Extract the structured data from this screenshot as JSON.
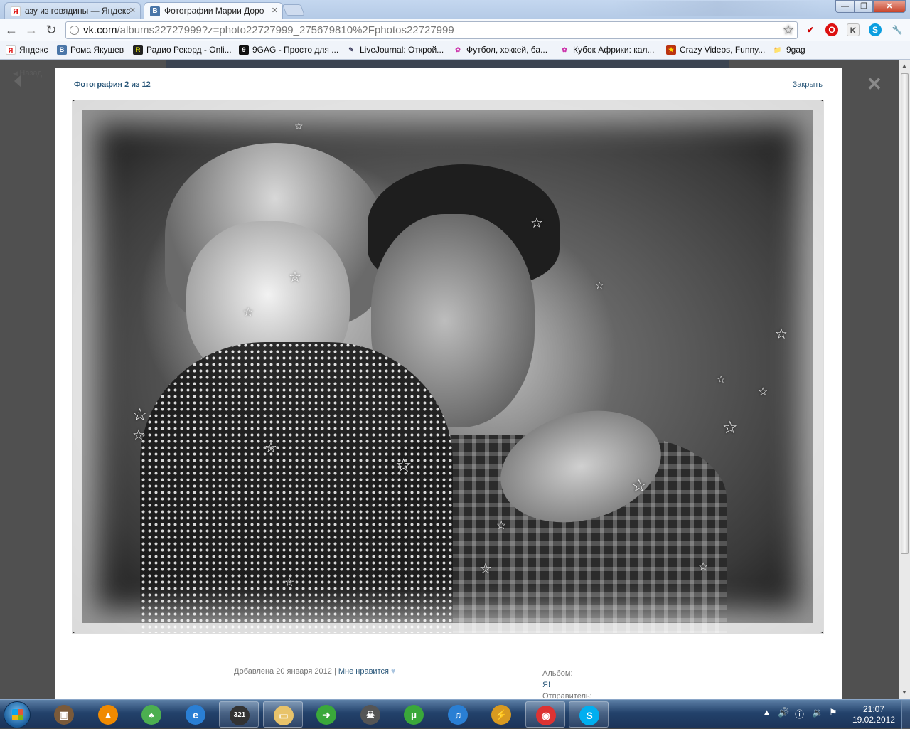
{
  "browser": {
    "tabs": [
      {
        "title": "азу из говядины — Яндекс",
        "favicon": "Я",
        "active": false
      },
      {
        "title": "Фотографии Марии Доро",
        "favicon": "В",
        "active": true
      }
    ],
    "url_host": "vk.com",
    "url_path": "/albums22727999?z=photo22727999_275679810%2Fphotos22727999",
    "bookmarks": [
      {
        "label": "Яндекс",
        "icon": "Я"
      },
      {
        "label": "Рома Якушев",
        "icon": "В"
      },
      {
        "label": "Радио Рекорд - Onli...",
        "icon": "R"
      },
      {
        "label": "9GAG - Просто для ...",
        "icon": "9"
      },
      {
        "label": "LiveJournal: Открой...",
        "icon": "✎"
      },
      {
        "label": "Футбол, хоккей, ба...",
        "icon": "✿"
      },
      {
        "label": "Кубок Африки: кал...",
        "icon": "✿"
      },
      {
        "label": "Crazy Videos, Funny...",
        "icon": "★"
      },
      {
        "label": "9gag",
        "icon": "📁"
      }
    ]
  },
  "page": {
    "back_label": "Назад",
    "counter": "Фотография 2 из 12",
    "close_label": "Закрыть",
    "added_text": "Добавлена 20 января 2012",
    "separator": "|",
    "like_label": "Мне нравится",
    "like_icon": "♥",
    "album_label": "Альбом:",
    "album_value": "Я!",
    "sender_label": "Отправитель:"
  },
  "taskbar": {
    "apps": [
      {
        "name": "archive-app-icon",
        "glyph": "▣",
        "color": "#7a5a3a",
        "open": false
      },
      {
        "name": "vlc-icon",
        "glyph": "▲",
        "color": "#f08a00",
        "open": false
      },
      {
        "name": "green-app-icon",
        "glyph": "♠",
        "color": "#4caf50",
        "open": false
      },
      {
        "name": "internet-explorer-icon",
        "glyph": "e",
        "color": "#2a7fd4",
        "open": false
      },
      {
        "name": "media-player-classic-icon",
        "glyph": "321",
        "color": "#333",
        "open": true
      },
      {
        "name": "file-explorer-icon",
        "glyph": "▭",
        "color": "#e8c36a",
        "open": true
      },
      {
        "name": "green-arrow-icon",
        "glyph": "➜",
        "color": "#3aa83a",
        "open": false
      },
      {
        "name": "alien-icon",
        "glyph": "☠",
        "color": "#555",
        "open": false
      },
      {
        "name": "utorrent-icon",
        "glyph": "µ",
        "color": "#3aa83a",
        "open": false
      },
      {
        "name": "itunes-icon",
        "glyph": "♫",
        "color": "#2a7fd4",
        "open": false
      },
      {
        "name": "winamp-icon",
        "glyph": "⚡",
        "color": "#d89a20",
        "open": false
      },
      {
        "name": "chrome-icon",
        "glyph": "◉",
        "color": "#d33",
        "open": true
      },
      {
        "name": "skype-icon",
        "glyph": "S",
        "color": "#00aff0",
        "open": true
      }
    ],
    "time": "21:07",
    "date": "19.02.2012"
  }
}
